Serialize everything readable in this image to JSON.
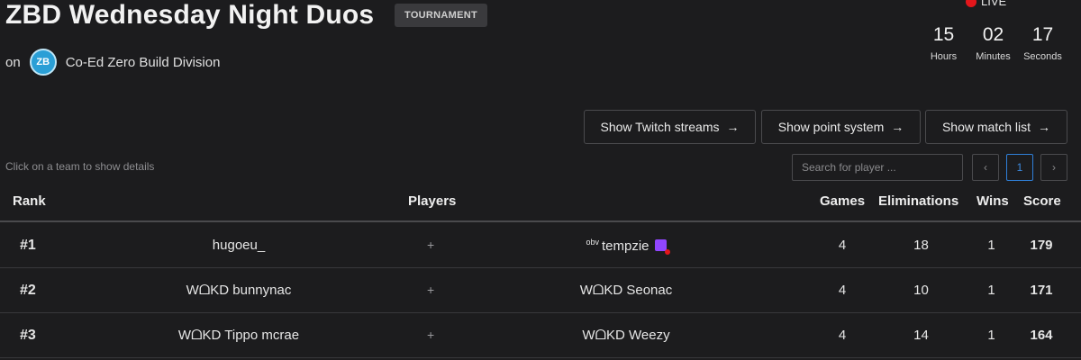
{
  "header": {
    "title": "ZBD Wednesday Night Duos",
    "badge": "TOURNAMENT",
    "on_prefix": "on",
    "division_logo_text": "ZB",
    "division_name": "Co-Ed Zero Build Division"
  },
  "live": {
    "label": "LIVE",
    "countdown": [
      {
        "value": "15",
        "label": "Hours"
      },
      {
        "value": "02",
        "label": "Minutes"
      },
      {
        "value": "17",
        "label": "Seconds"
      }
    ]
  },
  "actions": {
    "twitch_label": "Show Twitch streams",
    "points_label": "Show point system",
    "matches_label": "Show match list",
    "arrow_glyph": "→"
  },
  "hint": "Click on a team to show details",
  "search": {
    "placeholder": "Search for player ..."
  },
  "pagination": {
    "prev": "‹",
    "page": "1",
    "next": "›"
  },
  "table": {
    "headers": {
      "rank": "Rank",
      "players": "Players",
      "games": "Games",
      "eliminations": "Eliminations",
      "wins": "Wins",
      "score": "Score"
    },
    "rows": [
      {
        "rank": "#1",
        "player1": "hugoeu_",
        "sep": "+",
        "player2_prefix": "obv",
        "player2": "tempzie",
        "games": "4",
        "elims": "18",
        "wins": "1",
        "score": "179"
      },
      {
        "rank": "#2",
        "player1": "WᗝKD bunnynac",
        "sep": "+",
        "player2": "WᗝKD Seonac",
        "games": "4",
        "elims": "10",
        "wins": "1",
        "score": "171"
      },
      {
        "rank": "#3",
        "player1": "WᗝKD Tippo mcrae",
        "sep": "+",
        "player2": "WᗝKD Weezy",
        "games": "4",
        "elims": "14",
        "wins": "1",
        "score": "164"
      }
    ]
  },
  "colors": {
    "background": "#1c1c1e",
    "live": "#e3161b",
    "twitch": "#9146ff",
    "active_page": "#2f7fd8"
  }
}
